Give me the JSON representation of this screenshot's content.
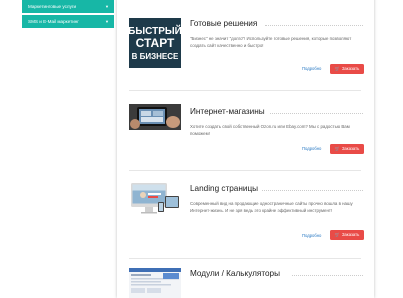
{
  "sidebar": {
    "items": [
      {
        "label": "Маркетинговые услуги"
      },
      {
        "label": "SMS и E-Mail маркетинг"
      }
    ]
  },
  "cards": [
    {
      "title": "Готовые решения",
      "description": "\"Бизнес\" не значит \"долго\"! Используйте готовые решения, которые позволяют создать сайт качественно и быстро!",
      "more_label": "Подробно",
      "order_label": "Заказать",
      "thumb_text": [
        "БЫСТРЫЙ",
        "СТАРТ",
        "В БИЗНЕСЕ"
      ]
    },
    {
      "title": "Интернет-магазины",
      "description": "Хотите создать свой собственный Ozon.ru или Ebay.com? Мы с радостью Вам поможем!",
      "more_label": "Подробно",
      "order_label": "Заказать"
    },
    {
      "title": "Landing страницы",
      "description": "Современный вид на продающие одностраничные сайты прочно вошла в нашу Интернет-жизнь. И не зря ведь это крайне эффективный инструмент!",
      "more_label": "Подробно",
      "order_label": "Заказать"
    },
    {
      "title": "Модули / Калькуляторы"
    }
  ],
  "colors": {
    "accent": "#17b7a6",
    "order_button": "#e94b47",
    "link": "#2a7ac4",
    "thumb_dark": "#1e3a4a"
  },
  "icons": {
    "chevron": "chevron-down-icon",
    "cart": "cart-icon"
  }
}
